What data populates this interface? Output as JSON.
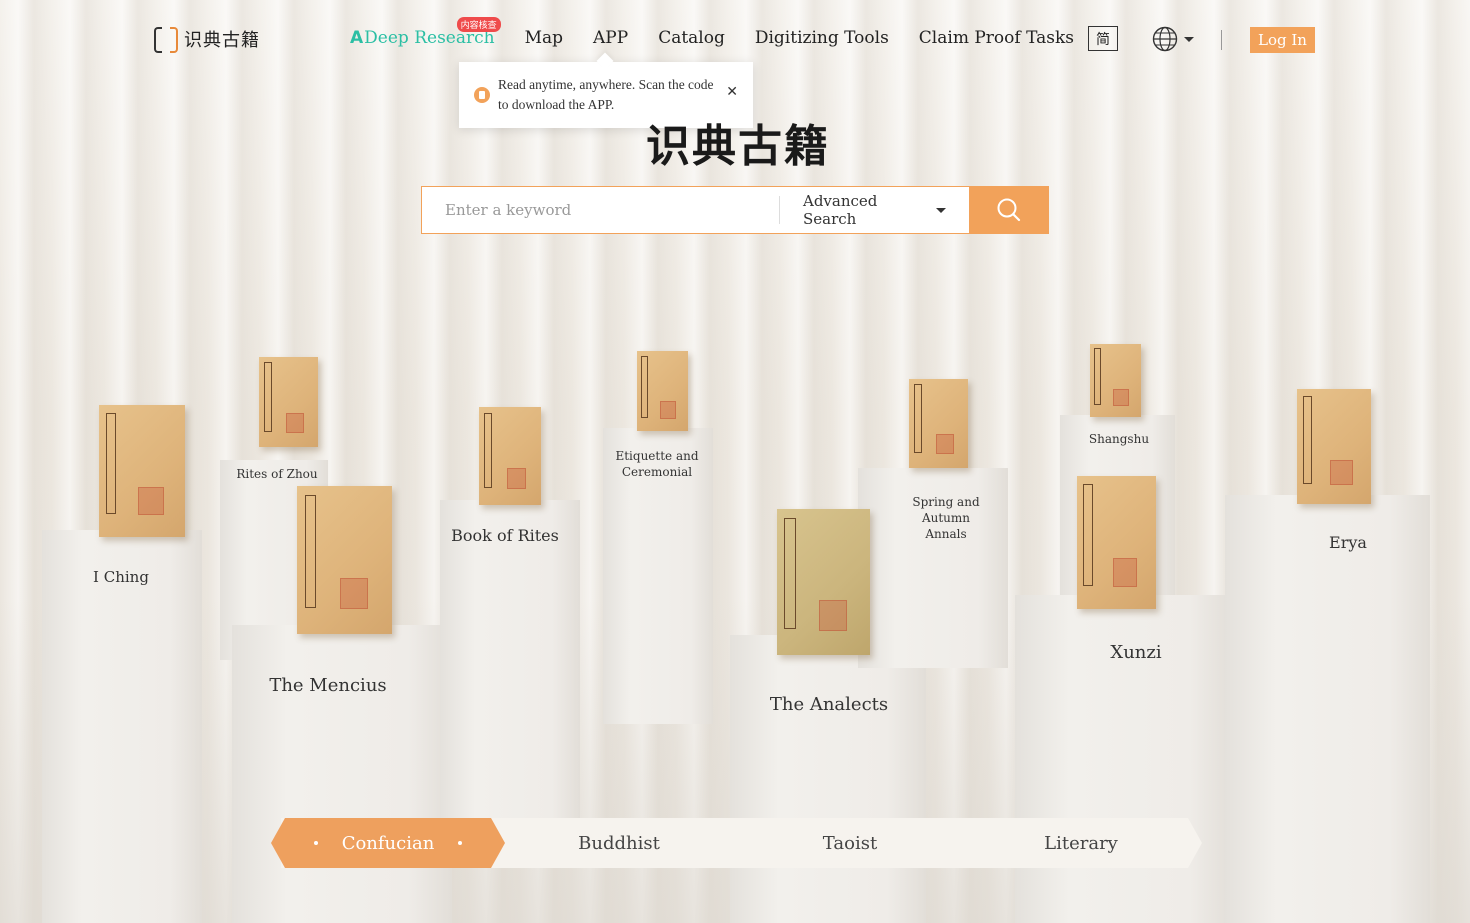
{
  "header": {
    "logo_text": "识典古籍",
    "nav": {
      "deep_research": "Deep Research",
      "deep_research_badge": "内容核查",
      "map": "Map",
      "app": "APP",
      "catalog": "Catalog",
      "digitizing_tools": "Digitizing Tools",
      "claim_proof_tasks": "Claim Proof Tasks"
    },
    "script_toggle": "简",
    "login": "Log In"
  },
  "popup": {
    "text": "Read anytime, anywhere. Scan the code to download the APP.",
    "close": "✕"
  },
  "hero": {
    "title": "识典古籍"
  },
  "search": {
    "placeholder": "Enter a keyword",
    "advanced": "Advanced Search"
  },
  "books": [
    "I Ching",
    "Rites of Zhou",
    "The Mencius",
    "Book of Rites",
    "Etiquette and Ceremonial",
    "The Analects",
    "Spring and Autumn Annals",
    "Shangshu",
    "Xunzi",
    "Erya"
  ],
  "tabs": [
    "Confucian",
    "Buddhist",
    "Taoist",
    "Literary"
  ],
  "colors": {
    "accent": "#f2a25a",
    "deep_research": "#2bbfa4",
    "badge": "#ef4b4b"
  }
}
